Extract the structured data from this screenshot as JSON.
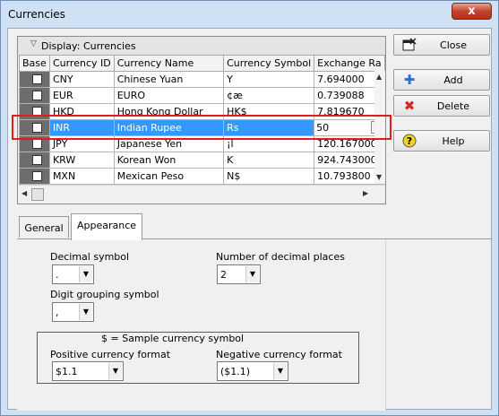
{
  "window": {
    "title": "Currencies",
    "close_glyph": "x"
  },
  "grid": {
    "caption": "Display: Currencies",
    "columns": [
      "Base",
      "Currency ID",
      "Currency Name",
      "Currency Symbol",
      "Exchange Ra"
    ],
    "rows": [
      {
        "id": "CNY",
        "name": "Chinese Yuan",
        "symbol": "Y",
        "rate": "7.694000"
      },
      {
        "id": "EUR",
        "name": "EURO",
        "symbol": "¢æ",
        "rate": "0.739088"
      },
      {
        "id": "HKD",
        "name": "Hong Kong Dollar",
        "symbol": "HK$",
        "rate": "7.819670"
      },
      {
        "id": "INR",
        "name": "Indian Rupee",
        "symbol": "Rs",
        "rate": "50"
      },
      {
        "id": "JPY",
        "name": "Japanese Yen",
        "symbol": "¡l",
        "rate": "120.167000"
      },
      {
        "id": "KRW",
        "name": "Korean Won",
        "symbol": "K",
        "rate": "924.743000"
      },
      {
        "id": "MXN",
        "name": "Mexican Peso",
        "symbol": "N$",
        "rate": "10.793800"
      }
    ],
    "selected_row_index": 3
  },
  "buttons": {
    "close": "Close",
    "add": "Add",
    "delete": "Delete",
    "help": "Help"
  },
  "tabs": {
    "general": "General",
    "appearance": "Appearance",
    "active": "appearance"
  },
  "appearance": {
    "decimal_symbol_label": "Decimal symbol",
    "decimal_symbol_value": ".",
    "decimal_places_label": "Number of decimal places",
    "decimal_places_value": "2",
    "digit_grouping_label": "Digit grouping symbol",
    "digit_grouping_value": ",",
    "sample_caption": "$ = Sample currency symbol",
    "positive_label": "Positive currency format",
    "positive_value": "$1.1",
    "negative_label": "Negative currency format",
    "negative_value": "($1.1)"
  },
  "colors": {
    "selection": "#3399ff",
    "highlight_border": "#e11b22",
    "title_bg": "#cfe1f4"
  }
}
